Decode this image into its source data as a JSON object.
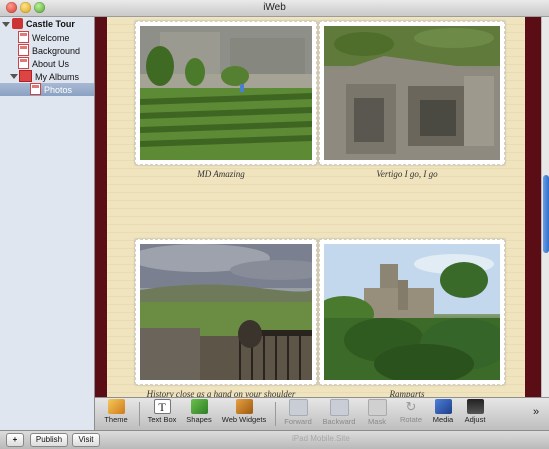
{
  "window": {
    "title": "iWeb"
  },
  "sidebar": {
    "site": "Castle Tour",
    "pages": [
      "Welcome",
      "Background",
      "About Us"
    ],
    "albums_label": "My Albums",
    "selected_page": "Photos"
  },
  "photos": [
    {
      "caption": "MD Amazing",
      "scene": "castle-hedge-maze"
    },
    {
      "caption": "Vertigo I go, I go",
      "scene": "castle-ruins-aerial"
    },
    {
      "caption": "History close as a hand on your shoulder",
      "scene": "valley-from-battlements"
    },
    {
      "caption": "Ramparts",
      "scene": "castle-on-hill-trees"
    }
  ],
  "toolbar": {
    "items": [
      {
        "label": "Theme",
        "icon": "theme-icon",
        "enabled": true
      },
      {
        "label": "Text Box",
        "icon": "text-box-icon",
        "enabled": true
      },
      {
        "label": "Shapes",
        "icon": "shapes-icon",
        "enabled": true
      },
      {
        "label": "Web Widgets",
        "icon": "web-widgets-icon",
        "enabled": true
      },
      {
        "label": "Forward",
        "icon": "forward-icon",
        "enabled": false
      },
      {
        "label": "Backward",
        "icon": "backward-icon",
        "enabled": false
      },
      {
        "label": "Mask",
        "icon": "mask-icon",
        "enabled": false
      },
      {
        "label": "Rotate",
        "icon": "rotate-icon",
        "enabled": false
      },
      {
        "label": "Media",
        "icon": "media-icon",
        "enabled": true
      },
      {
        "label": "Adjust",
        "icon": "adjust-icon",
        "enabled": true
      }
    ],
    "overflow": "»"
  },
  "bottombar": {
    "add": "+",
    "publish": "Publish",
    "visit": "Visit",
    "ghost_text": "iPad Mobile.Site"
  },
  "colors": {
    "page_border": "#5a0d14",
    "paper": "#f0e4be",
    "selection": "#8ba1c3"
  }
}
